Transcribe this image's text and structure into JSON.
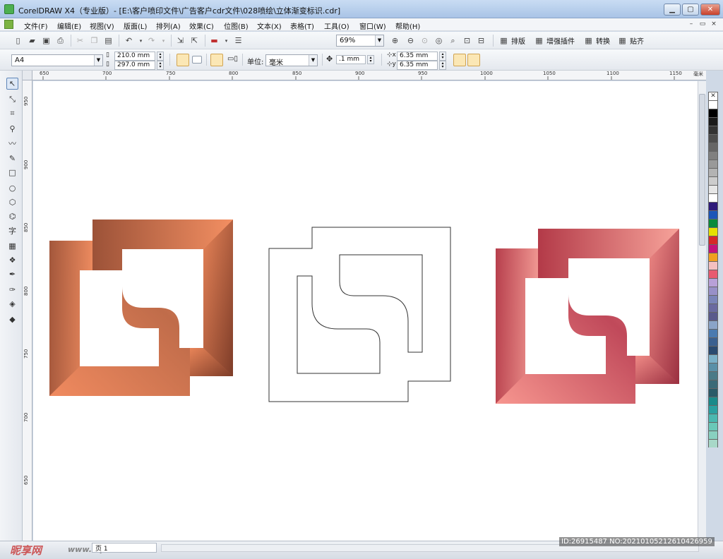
{
  "window": {
    "title": "CorelDRAW X4（专业版）- [E:\\客户喷印文件\\广告客户cdr文件\\028喷绘\\立体渐变标识.cdr]"
  },
  "menu": {
    "items": [
      "文件(F)",
      "编辑(E)",
      "视图(V)",
      "版面(L)",
      "排列(A)",
      "效果(C)",
      "位图(B)",
      "文本(X)",
      "表格(T)",
      "工具(O)",
      "窗口(W)",
      "帮助(H)"
    ]
  },
  "toolbar": {
    "zoom": "69%",
    "layout_label": "排版",
    "plugin_label": "增强插件",
    "convert_label": "转换",
    "align_label": "贴齐"
  },
  "property_bar": {
    "paper_size": "A4",
    "width": "210.0 mm",
    "height": "297.0 mm",
    "unit_label": "单位:",
    "unit_value": "毫米",
    "nudge": ".1 mm",
    "dup_x": "6.35 mm",
    "dup_y": "6.35 mm"
  },
  "rulers": {
    "h": [
      "650",
      "700",
      "750",
      "800",
      "850",
      "900",
      "950",
      "1000",
      "1050",
      "1100",
      "1150"
    ],
    "h_unit": "毫米",
    "v": [
      "950",
      "900",
      "850",
      "800",
      "750",
      "700",
      "650"
    ]
  },
  "colors": {
    "copper_light": "#f08a5f",
    "copper_dark": "#8a4530",
    "rose_light": "#f59a94",
    "rose_dark": "#a8384a"
  },
  "palette": [
    "#ffffff",
    "#000000",
    "#1a1a1a",
    "#333333",
    "#4d4d4d",
    "#666666",
    "#808080",
    "#999999",
    "#b3b3b3",
    "#cccccc",
    "#e6e6e6",
    "#ffffff",
    "#2e1a7a",
    "#1c55b8",
    "#0a8a3a",
    "#e6e000",
    "#d62828",
    "#c4127a",
    "#f0a020",
    "#f5c0c0",
    "#e85a70",
    "#b8a0d8",
    "#9890c8",
    "#7a84b8",
    "#6a6aa0",
    "#5a5a8c",
    "#8aa4c8",
    "#4a7ab0",
    "#3a6090",
    "#2a4a70",
    "#7ab0c8",
    "#5a90a8",
    "#4a7a88",
    "#3a6a78",
    "#2a5a68",
    "#1a8a8a",
    "#2aa0a0",
    "#4ab8b0",
    "#6ac8b8",
    "#88d0c0",
    "#a8d8c8"
  ],
  "status": {
    "page_tab": "页 1",
    "watermark_logo": "昵享网",
    "watermark_url": "www.nipic.cn",
    "image_id": "ID:26915487 NO:20210105212610426959"
  }
}
